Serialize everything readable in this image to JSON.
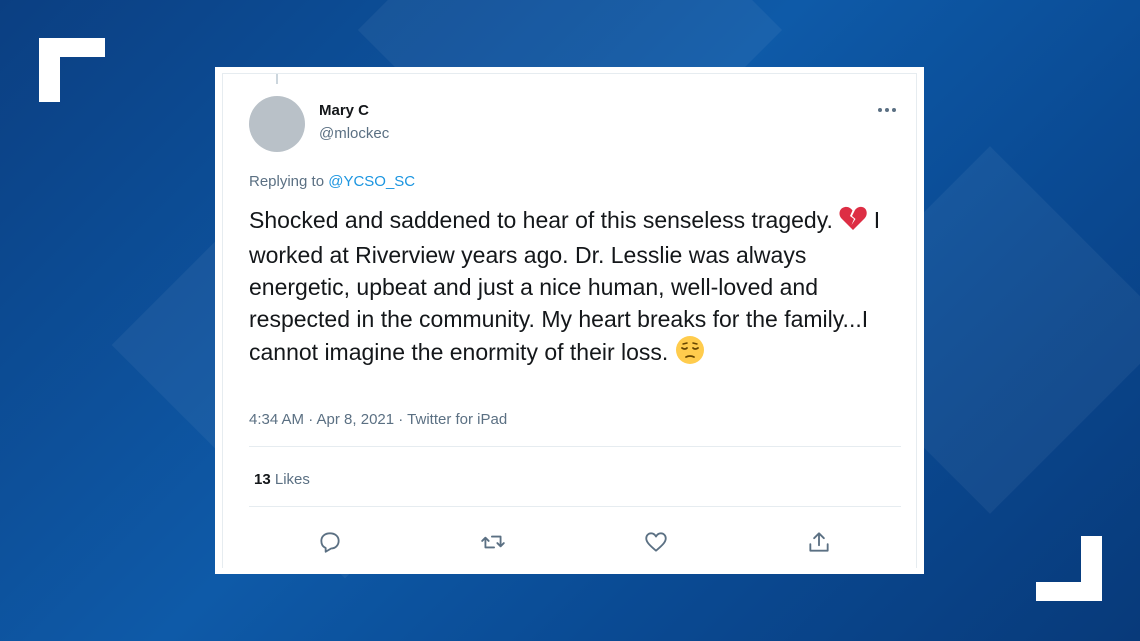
{
  "tweet": {
    "author_name": "Mary C",
    "author_handle": "@mlockec",
    "replying_prefix": "Replying to",
    "replying_to": "@YCSO_SC",
    "text_part1": "Shocked and saddened to hear of this senseless tragedy.",
    "text_part2": "I worked at Riverview years ago. Dr. Lesslie was always energetic, upbeat and just a nice human, well-loved and respected in the community. My heart breaks for the family...I cannot imagine the enormity of their loss.",
    "timestamp": "4:34 AM · Apr 8, 2021 · Twitter for iPad",
    "likes_count": "13",
    "likes_label": "Likes"
  },
  "icons": {
    "emoji_1": "broken-heart",
    "emoji_2": "pensive-face",
    "actions": [
      "reply-icon",
      "retweet-icon",
      "like-icon",
      "share-icon"
    ]
  },
  "colors": {
    "background": "#0e5aa8",
    "link": "#1b95e0",
    "muted": "#5b7083",
    "text": "#14171a"
  }
}
